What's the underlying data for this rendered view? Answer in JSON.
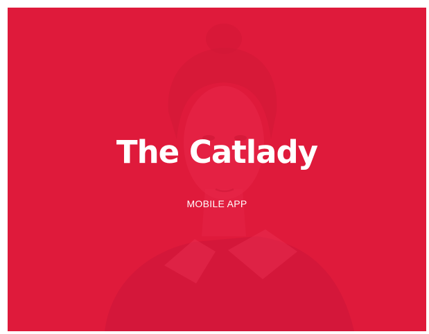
{
  "hero": {
    "title": "The Catlady",
    "subtitle": "MOBILE APP",
    "background_color": "#df1a3b",
    "text_color": "#ffffff"
  }
}
